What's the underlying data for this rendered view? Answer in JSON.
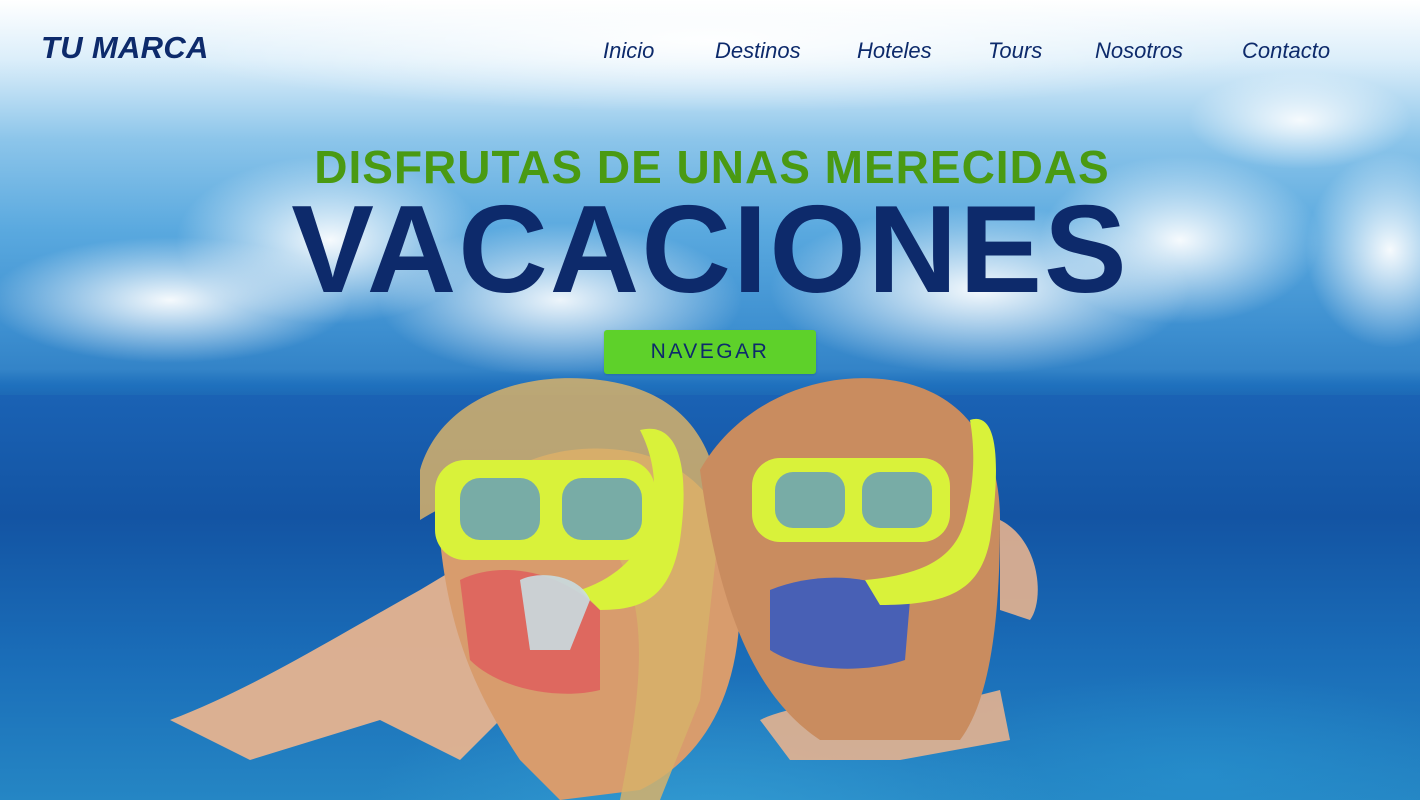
{
  "brand": {
    "logo_text": "TU MARCA",
    "color": "#0d2a6b"
  },
  "nav": {
    "items": [
      {
        "label": "Inicio"
      },
      {
        "label": "Destinos"
      },
      {
        "label": "Hoteles"
      },
      {
        "label": "Tours"
      },
      {
        "label": "Nosotros"
      },
      {
        "label": "Contacto"
      }
    ]
  },
  "hero": {
    "subtitle": "DISFRUTAS DE UNAS MERECIDAS",
    "title": "VACACIONES",
    "cta_label": "NAVEGAR",
    "accent_color": "#5ed12a",
    "subtitle_color": "#4a9a12",
    "background_image": "two children snorkeling underwater with yellow masks, sky with clouds above water line"
  }
}
